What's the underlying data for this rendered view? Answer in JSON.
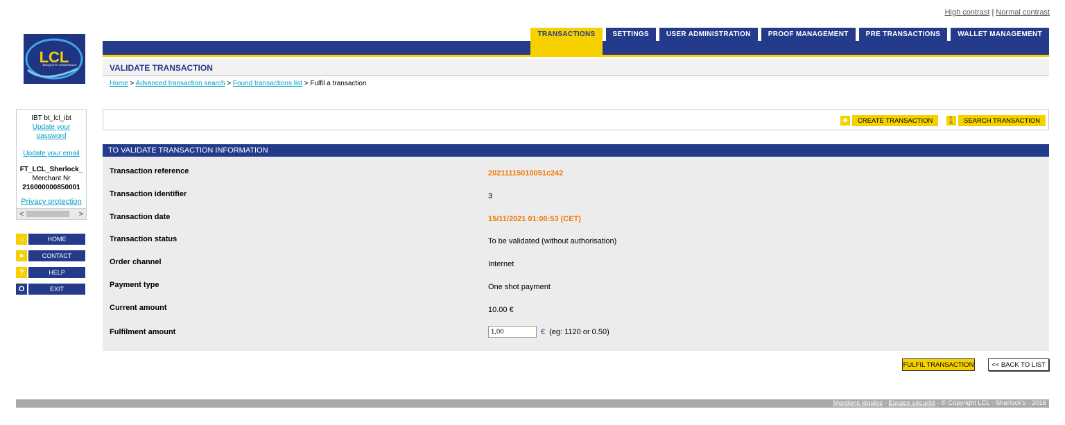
{
  "contrast": {
    "high": "High contrast",
    "separator": "|",
    "normal": "Normal contrast"
  },
  "logo": {
    "text": "LCL",
    "subtitle": "BANQUE ET ASSURANCE"
  },
  "tabs": [
    {
      "label": "TRANSACTIONS",
      "active": true
    },
    {
      "label": "SETTINGS"
    },
    {
      "label": "USER ADMINISTRATION"
    },
    {
      "label": "PROOF MANAGEMENT"
    },
    {
      "label": "PRE TRANSACTIONS"
    },
    {
      "label": "WALLET MANAGEMENT"
    }
  ],
  "page_title": "VALIDATE TRANSACTION",
  "breadcrumb": [
    {
      "label": "Home",
      "link": true
    },
    {
      "label": "Advanced transaction search",
      "link": true
    },
    {
      "label": "Found transactions list",
      "link": true
    },
    {
      "label": "Fulfil a transaction",
      "link": false
    }
  ],
  "breadcrumb_sep": ">",
  "user": {
    "name": "IBT bt_lcl_ibt",
    "update_password": "Update your password",
    "update_email": "Update your email",
    "shop": "FT_LCL_Sherlock_",
    "merchant_label": "Merchant Nr",
    "merchant_nr": "216000000850001",
    "privacy": "Privacy protection",
    "scroll_left": "<",
    "scroll_right": ">"
  },
  "menu": [
    {
      "label": "HOME",
      "icon": "home-icon",
      "glyph": "⌂"
    },
    {
      "label": "CONTACT",
      "icon": "speech-bubble-icon",
      "glyph": "●"
    },
    {
      "label": "HELP",
      "icon": "help-icon",
      "glyph": "?"
    },
    {
      "label": "EXIT",
      "icon": "exit-icon",
      "glyph": "O"
    }
  ],
  "actions": {
    "create": "CREATE TRANSACTION",
    "search": "SEARCH TRANSACTION"
  },
  "panel": {
    "title": "TO VALIDATE TRANSACTION INFORMATION",
    "rows": [
      {
        "label": "Transaction reference",
        "value": "20211115010051c242",
        "highlight": true
      },
      {
        "label": "Transaction identifier",
        "value": "3"
      },
      {
        "label": "Transaction date",
        "value": "15/11/2021 01:00:53 (CET)",
        "highlight": true
      },
      {
        "label": "Transaction status",
        "value": "To be validated (without authorisation)"
      },
      {
        "label": "Order channel",
        "value": "Internet"
      },
      {
        "label": "Payment type",
        "value": "One shot payment"
      },
      {
        "label": "Current amount",
        "value": "10.00  €"
      }
    ],
    "fulfilment_label": "Fulfilment amount",
    "fulfilment_value": "1,00",
    "currency": "€",
    "example": "(eg: 1120 or 0.50)"
  },
  "buttons": {
    "fulfil": "FULFIL TRANSACTION",
    "back": "<< BACK TO LIST"
  },
  "footer": {
    "legal": "Mentions légales",
    "dash1": " - ",
    "security": "Espace sécurité",
    "copyright": " - © Copyright LCL - Sherlock's - 2016"
  },
  "colors": {
    "brand_blue": "#243a8a",
    "accent_yellow": "#f7d000",
    "highlight_orange": "#f07800",
    "link": "#00a0c6"
  }
}
